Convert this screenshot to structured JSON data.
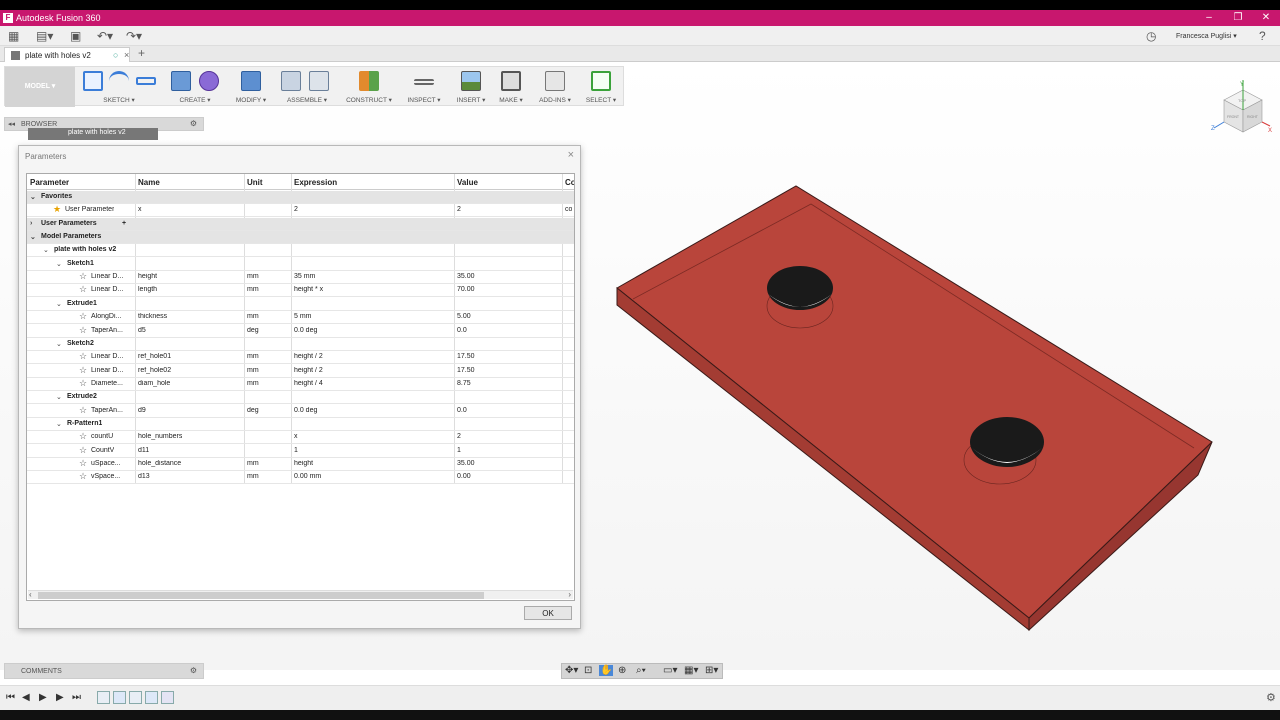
{
  "app": {
    "title": "Autodesk Fusion 360",
    "logo": "F",
    "user": "Francesca Puglisi ▾",
    "brand_color": "#c8176e"
  },
  "document_tab": {
    "label": "plate with holes v2",
    "close": "×",
    "new": "+"
  },
  "ribbon": {
    "workspace": "MODEL ▾",
    "groups": [
      {
        "label": "SKETCH ▾"
      },
      {
        "label": "CREATE ▾"
      },
      {
        "label": "MODIFY ▾"
      },
      {
        "label": "ASSEMBLE ▾"
      },
      {
        "label": "CONSTRUCT ▾"
      },
      {
        "label": "INSPECT ▾"
      },
      {
        "label": "INSERT ▾"
      },
      {
        "label": "MAKE ▾"
      },
      {
        "label": "ADD-INS ▾"
      },
      {
        "label": "SELECT ▾"
      }
    ]
  },
  "browser": {
    "label": "BROWSER",
    "node": "plate with holes v2"
  },
  "comments": {
    "label": "COMMENTS"
  },
  "dialog": {
    "title": "Parameters",
    "close": "×",
    "ok_label": "OK",
    "columns": [
      "Parameter",
      "Name",
      "Unit",
      "Expression",
      "Value",
      "Co"
    ],
    "rows": [
      {
        "type": "section",
        "toggle": "⌄",
        "label": "Favorites"
      },
      {
        "type": "param",
        "indent": 1,
        "star": "★",
        "gold": true,
        "param": "User Parameter",
        "name": "x",
        "unit": "",
        "expr": "2",
        "value": "2",
        "comment": "co"
      },
      {
        "type": "section",
        "toggle": "›",
        "label": "User Parameters",
        "extra": "+"
      },
      {
        "type": "section",
        "toggle": "⌄",
        "label": "Model Parameters"
      },
      {
        "type": "group",
        "indent": 1,
        "toggle": "⌄",
        "label": "plate with holes v2"
      },
      {
        "type": "group",
        "indent": 2,
        "toggle": "⌄",
        "label": "Sketch1"
      },
      {
        "type": "param",
        "indent": 3,
        "star": "☆",
        "param": "Linear D...",
        "name": "height",
        "unit": "mm",
        "expr": "35 mm",
        "value": "35.00"
      },
      {
        "type": "param",
        "indent": 3,
        "star": "☆",
        "param": "Linear D...",
        "name": "length",
        "unit": "mm",
        "expr": "height * x",
        "value": "70.00"
      },
      {
        "type": "group",
        "indent": 2,
        "toggle": "⌄",
        "label": "Extrude1"
      },
      {
        "type": "param",
        "indent": 3,
        "star": "☆",
        "param": "AlongDi...",
        "name": "thickness",
        "unit": "mm",
        "expr": "5 mm",
        "value": "5.00"
      },
      {
        "type": "param",
        "indent": 3,
        "star": "☆",
        "param": "TaperAn...",
        "name": "d5",
        "unit": "deg",
        "expr": "0.0 deg",
        "value": "0.0"
      },
      {
        "type": "group",
        "indent": 2,
        "toggle": "⌄",
        "label": "Sketch2"
      },
      {
        "type": "param",
        "indent": 3,
        "star": "☆",
        "param": "Linear D...",
        "name": "ref_hole01",
        "unit": "mm",
        "expr": "height / 2",
        "value": "17.50"
      },
      {
        "type": "param",
        "indent": 3,
        "star": "☆",
        "param": "Linear D...",
        "name": "ref_hole02",
        "unit": "mm",
        "expr": "height / 2",
        "value": "17.50"
      },
      {
        "type": "param",
        "indent": 3,
        "star": "☆",
        "param": "Diamete...",
        "name": "diam_hole",
        "unit": "mm",
        "expr": "height / 4",
        "value": "8.75"
      },
      {
        "type": "group",
        "indent": 2,
        "toggle": "⌄",
        "label": "Extrude2"
      },
      {
        "type": "param",
        "indent": 3,
        "star": "☆",
        "param": "TaperAn...",
        "name": "d9",
        "unit": "deg",
        "expr": "0.0 deg",
        "value": "0.0"
      },
      {
        "type": "group",
        "indent": 2,
        "toggle": "⌄",
        "label": "R-Pattern1"
      },
      {
        "type": "param",
        "indent": 3,
        "star": "☆",
        "param": "countU",
        "name": "hole_numbers",
        "unit": "",
        "expr": "x",
        "value": "2"
      },
      {
        "type": "param",
        "indent": 3,
        "star": "☆",
        "param": "CountV",
        "name": "d11",
        "unit": "",
        "expr": "1",
        "value": "1"
      },
      {
        "type": "param",
        "indent": 3,
        "star": "☆",
        "param": "uSpace...",
        "name": "hole_distance",
        "unit": "mm",
        "expr": "height",
        "value": "35.00"
      },
      {
        "type": "param",
        "indent": 3,
        "star": "☆",
        "param": "vSpace...",
        "name": "d13",
        "unit": "mm",
        "expr": "0.00 mm",
        "value": "0.00"
      }
    ]
  },
  "viewcube": {
    "front": "FRONT",
    "right": "RIGHT",
    "top": "TOP",
    "x": "X",
    "y": "Y",
    "z": "Z"
  },
  "model_color": "#b9453b"
}
